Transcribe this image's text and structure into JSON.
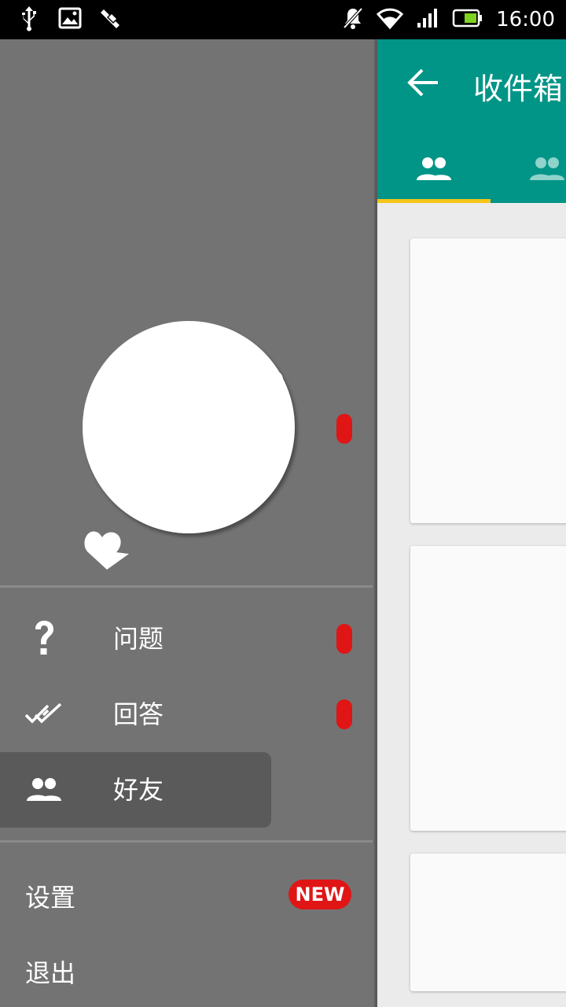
{
  "status_bar": {
    "time": "16:00",
    "left_icons": [
      "usb-icon",
      "image-icon",
      "debug-icon"
    ],
    "right_icons": [
      "mute-icon",
      "wifi-icon",
      "signal-icon",
      "battery-icon"
    ]
  },
  "app": {
    "title": "收件箱",
    "tabs": [
      {
        "icon": "people-icon",
        "active": true
      },
      {
        "icon": "people-icon",
        "active": false
      }
    ],
    "cards_visible": 3,
    "colors": {
      "appbar": "#009587",
      "indicator": "#f5c518"
    }
  },
  "drawer": {
    "menu": [
      {
        "label": "问题",
        "icon": "question-icon",
        "has_dot": true
      },
      {
        "label": "回答",
        "icon": "double-check-icon",
        "has_dot": true
      },
      {
        "label": "好友",
        "icon": "people-icon",
        "active": true
      }
    ],
    "settings_label": "设置",
    "settings_badge": "NEW",
    "logout_label": "退出",
    "colors": {
      "background": "#737373",
      "badge": "#e01515",
      "active": "#5a5a5a"
    }
  }
}
